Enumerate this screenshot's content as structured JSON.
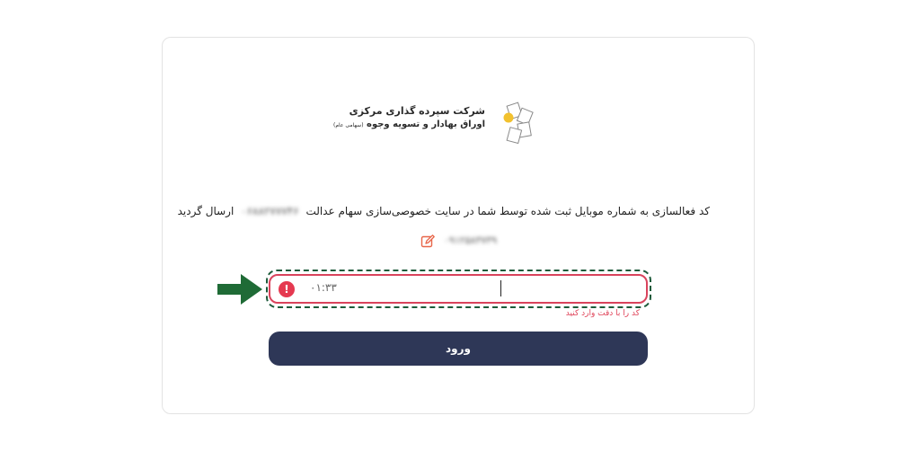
{
  "logo": {
    "line1": "شرکت سپرده گذاری مرکزی",
    "line2": "اوراق بهادار و تسویه وجوه",
    "line2_note": "(سهامی عام)"
  },
  "message": {
    "before": "کد فعالسازی به شماره موبایل ثبت شده توسط شما در سایت خصوصی‌سازی سهام عدالت",
    "masked_id": "۰۶۸۸۲۷۷۷۴۶",
    "after": "ارسال گردید"
  },
  "phone": {
    "masked": "۰۹۱۲۵۸۳۷۳۹"
  },
  "otp_input": {
    "timer": "۰۱:۳۳",
    "value": ""
  },
  "error": {
    "text": "کد را با دقت وارد کنید"
  },
  "submit": {
    "label": "ورود"
  },
  "colors": {
    "button": "#2e3757",
    "error": "#e53950",
    "annotation_arrow": "#1f6b36"
  }
}
